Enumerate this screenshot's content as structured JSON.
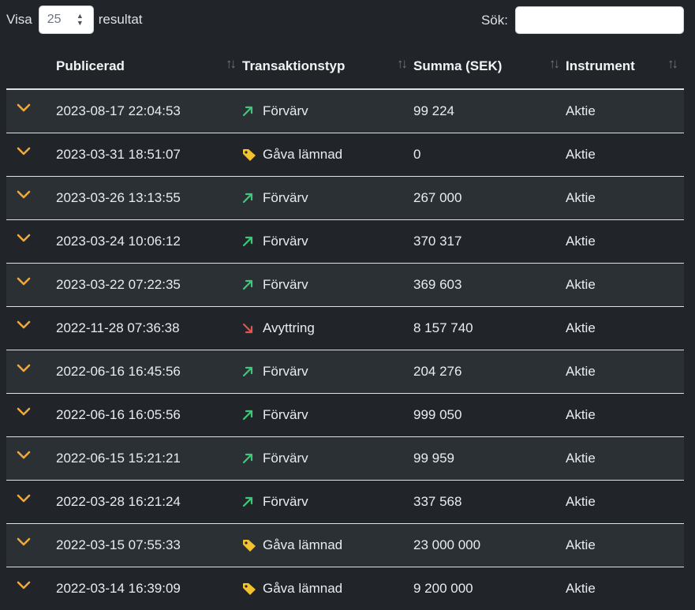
{
  "controls": {
    "show_label": "Visa",
    "show_value": "25",
    "show_suffix": "resultat",
    "search_label": "Sök:",
    "search_value": ""
  },
  "columns": [
    "Publicerad",
    "Transaktionstyp",
    "Summa (SEK)",
    "Instrument"
  ],
  "colors": {
    "acquisition": "#3ec97a",
    "disposal": "#e5534b",
    "gift": "#f2c230",
    "chevron": "#f0a83a"
  },
  "rows": [
    {
      "published": "2023-08-17 22:04:53",
      "type": "Förvärv",
      "type_icon": "arrow-up-right-icon",
      "amount": "99 224",
      "instrument": "Aktie"
    },
    {
      "published": "2023-03-31 18:51:07",
      "type": "Gåva lämnad",
      "type_icon": "tag-icon",
      "amount": "0",
      "instrument": "Aktie"
    },
    {
      "published": "2023-03-26 13:13:55",
      "type": "Förvärv",
      "type_icon": "arrow-up-right-icon",
      "amount": "267 000",
      "instrument": "Aktie"
    },
    {
      "published": "2023-03-24 10:06:12",
      "type": "Förvärv",
      "type_icon": "arrow-up-right-icon",
      "amount": "370 317",
      "instrument": "Aktie"
    },
    {
      "published": "2023-03-22 07:22:35",
      "type": "Förvärv",
      "type_icon": "arrow-up-right-icon",
      "amount": "369 603",
      "instrument": "Aktie"
    },
    {
      "published": "2022-11-28 07:36:38",
      "type": "Avyttring",
      "type_icon": "arrow-down-right-icon",
      "amount": "8 157 740",
      "instrument": "Aktie"
    },
    {
      "published": "2022-06-16 16:45:56",
      "type": "Förvärv",
      "type_icon": "arrow-up-right-icon",
      "amount": "204 276",
      "instrument": "Aktie"
    },
    {
      "published": "2022-06-16 16:05:56",
      "type": "Förvärv",
      "type_icon": "arrow-up-right-icon",
      "amount": "999 050",
      "instrument": "Aktie"
    },
    {
      "published": "2022-06-15 15:21:21",
      "type": "Förvärv",
      "type_icon": "arrow-up-right-icon",
      "amount": "99 959",
      "instrument": "Aktie"
    },
    {
      "published": "2022-03-28 16:21:24",
      "type": "Förvärv",
      "type_icon": "arrow-up-right-icon",
      "amount": "337 568",
      "instrument": "Aktie"
    },
    {
      "published": "2022-03-15 07:55:33",
      "type": "Gåva lämnad",
      "type_icon": "tag-icon",
      "amount": "23 000 000",
      "instrument": "Aktie"
    },
    {
      "published": "2022-03-14 16:39:09",
      "type": "Gåva lämnad",
      "type_icon": "tag-icon",
      "amount": "9 200 000",
      "instrument": "Aktie"
    }
  ]
}
